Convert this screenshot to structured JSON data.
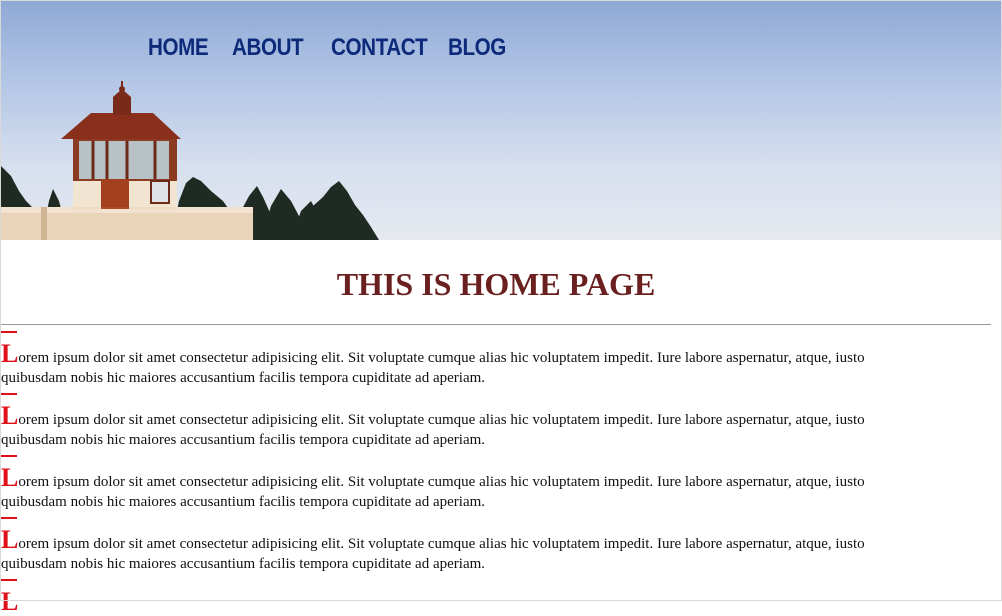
{
  "nav": {
    "items": [
      {
        "label": "HOME"
      },
      {
        "label": "ABOUT"
      },
      {
        "label": "CONTACT"
      },
      {
        "label": "BLOG"
      }
    ]
  },
  "main": {
    "title": "THIS IS HOME PAGE",
    "paragraphs": [
      {
        "initial": "L",
        "text": "orem ipsum dolor sit amet consectetur adipisicing elit. Sit voluptate cumque alias hic voluptatem impedit. Iure labore aspernatur, atque, iusto quibusdam nobis hic maiores accusantium facilis tempora cupiditate ad aperiam."
      },
      {
        "initial": "L",
        "text": "orem ipsum dolor sit amet consectetur adipisicing elit. Sit voluptate cumque alias hic voluptatem impedit. Iure labore aspernatur, atque, iusto quibusdam nobis hic maiores accusantium facilis tempora cupiditate ad aperiam."
      },
      {
        "initial": "L",
        "text": "orem ipsum dolor sit amet consectetur adipisicing elit. Sit voluptate cumque alias hic voluptatem impedit. Iure labore aspernatur, atque, iusto quibusdam nobis hic maiores accusantium facilis tempora cupiditate ad aperiam."
      },
      {
        "initial": "L",
        "text": "orem ipsum dolor sit amet consectetur adipisicing elit. Sit voluptate cumque alias hic voluptatem impedit. Iure labore aspernatur, atque, iusto quibusdam nobis hic maiores accusantium facilis tempora cupiditate ad aperiam."
      },
      {
        "initial": "L",
        "text": ""
      }
    ]
  },
  "colors": {
    "nav_text": "#0d2a7a",
    "title": "#6b2020",
    "drop_cap": "#e0101b"
  }
}
